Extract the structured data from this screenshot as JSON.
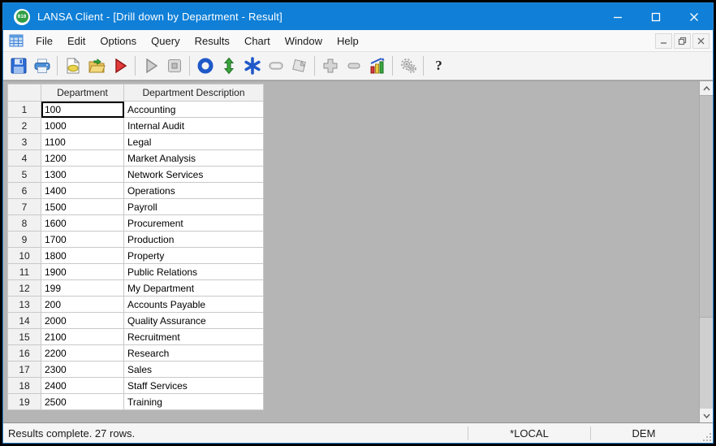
{
  "window": {
    "title": "LANSA Client - [Drill down by Department - Result]",
    "logo_text": "010"
  },
  "menu": {
    "items": [
      {
        "label": "File"
      },
      {
        "label": "Edit"
      },
      {
        "label": "Options"
      },
      {
        "label": "Query"
      },
      {
        "label": "Results"
      },
      {
        "label": "Chart"
      },
      {
        "label": "Window"
      },
      {
        "label": "Help"
      }
    ]
  },
  "toolbar": {
    "icons": [
      "save",
      "print",
      "new-query",
      "open-folder",
      "run",
      "play",
      "stop",
      "ring",
      "expand-arrows",
      "asterisk",
      "band",
      "report-card",
      "add",
      "remove",
      "chart",
      "settings-gears",
      "help"
    ],
    "help_label": "?"
  },
  "table": {
    "columns": [
      "Department",
      "Department Description"
    ],
    "rows": [
      {
        "num": "1",
        "department": "100",
        "description": "Accounting",
        "selected": true
      },
      {
        "num": "2",
        "department": "1000",
        "description": "Internal Audit"
      },
      {
        "num": "3",
        "department": "1100",
        "description": "Legal"
      },
      {
        "num": "4",
        "department": "1200",
        "description": "Market Analysis"
      },
      {
        "num": "5",
        "department": "1300",
        "description": "Network Services"
      },
      {
        "num": "6",
        "department": "1400",
        "description": "Operations"
      },
      {
        "num": "7",
        "department": "1500",
        "description": "Payroll"
      },
      {
        "num": "8",
        "department": "1600",
        "description": "Procurement"
      },
      {
        "num": "9",
        "department": "1700",
        "description": "Production"
      },
      {
        "num": "10",
        "department": "1800",
        "description": "Property"
      },
      {
        "num": "11",
        "department": "1900",
        "description": "Public Relations"
      },
      {
        "num": "12",
        "department": "199",
        "description": "My Department"
      },
      {
        "num": "13",
        "department": "200",
        "description": "Accounts Payable"
      },
      {
        "num": "14",
        "department": "2000",
        "description": "Quality Assurance"
      },
      {
        "num": "15",
        "department": "2100",
        "description": "Recruitment"
      },
      {
        "num": "16",
        "department": "2200",
        "description": "Research"
      },
      {
        "num": "17",
        "department": "2300",
        "description": "Sales"
      },
      {
        "num": "18",
        "department": "2400",
        "description": "Staff Services"
      },
      {
        "num": "19",
        "department": "2500",
        "description": "Training"
      }
    ]
  },
  "status_bar": {
    "message": "Results complete. 27 rows.",
    "server": "*LOCAL",
    "partition": "DEM"
  },
  "colors": {
    "titlebar_blue": "#0f7fd7",
    "client_gray": "#b5b5b5",
    "accent_border": "#2a86d4"
  }
}
